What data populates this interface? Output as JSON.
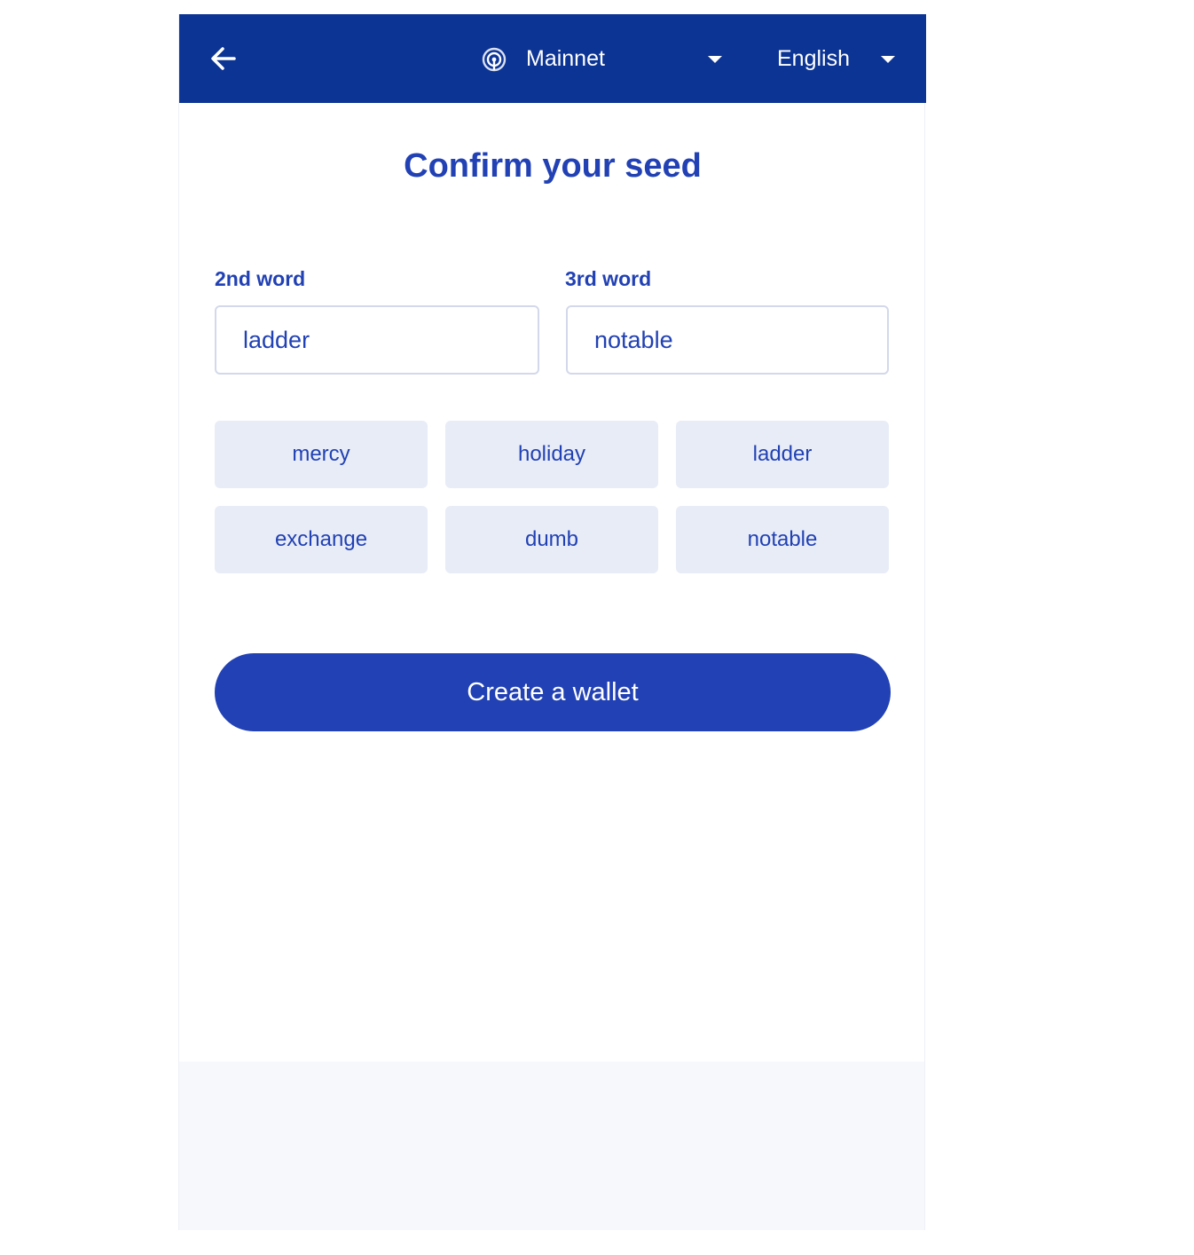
{
  "header": {
    "back_icon": "arrow-left-icon",
    "network_icon": "signal-icon",
    "network_label": "Mainnet",
    "language_label": "English",
    "background_color": "#0c3494"
  },
  "page": {
    "title": "Confirm your seed"
  },
  "fields": [
    {
      "label": "2nd word",
      "value": "ladder"
    },
    {
      "label": "3rd word",
      "value": "notable"
    }
  ],
  "word_options": [
    "mercy",
    "holiday",
    "ladder",
    "exchange",
    "dumb",
    "notable"
  ],
  "actions": {
    "create_label": "Create a wallet"
  },
  "colors": {
    "accent": "#2141b4",
    "chip_background": "#e8ecf6"
  }
}
